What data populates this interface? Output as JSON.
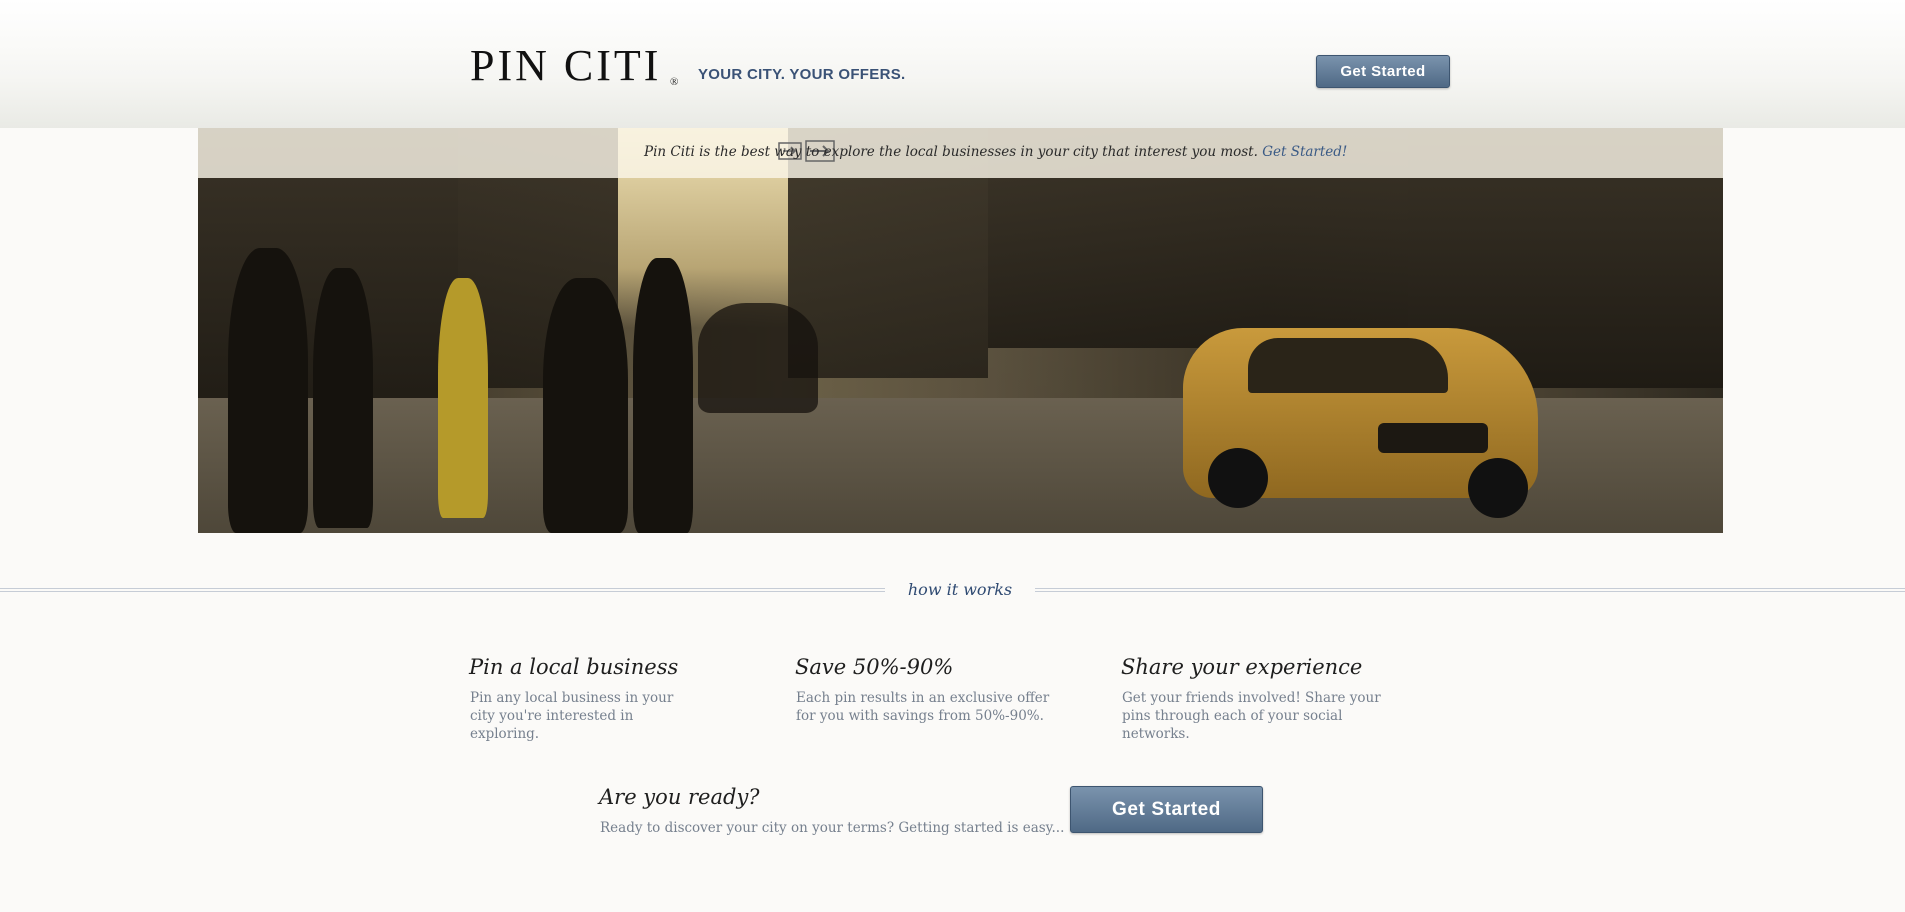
{
  "header": {
    "logo": "PIN CITI",
    "logo_mark": "®",
    "tagline": "YOUR CITY. YOUR OFFERS.",
    "get_started_label": "Get Started"
  },
  "hero": {
    "banner_text": "Pin Citi is the best way to explore the local businesses in your city that interest you most.",
    "banner_link": "Get Started!",
    "banner_icon": "arrow-sign-icon"
  },
  "how_it_works": {
    "title": "how it works",
    "features": [
      {
        "title": "Pin a local business",
        "description": "Pin any local business in your city you're interested in exploring."
      },
      {
        "title": "Save 50%-90%",
        "description": "Each pin results in an exclusive offer for you with savings from 50%-90%."
      },
      {
        "title": "Share your experience",
        "description": "Get your friends involved! Share your pins through each of your social networks."
      }
    ]
  },
  "cta": {
    "title": "Are you ready?",
    "description": "Ready to discover your city on your terms? Getting started is easy...",
    "button_label": "Get Started"
  },
  "colors": {
    "accent": "#3a5276",
    "button": "#5a7390",
    "muted_text": "#76808e"
  }
}
